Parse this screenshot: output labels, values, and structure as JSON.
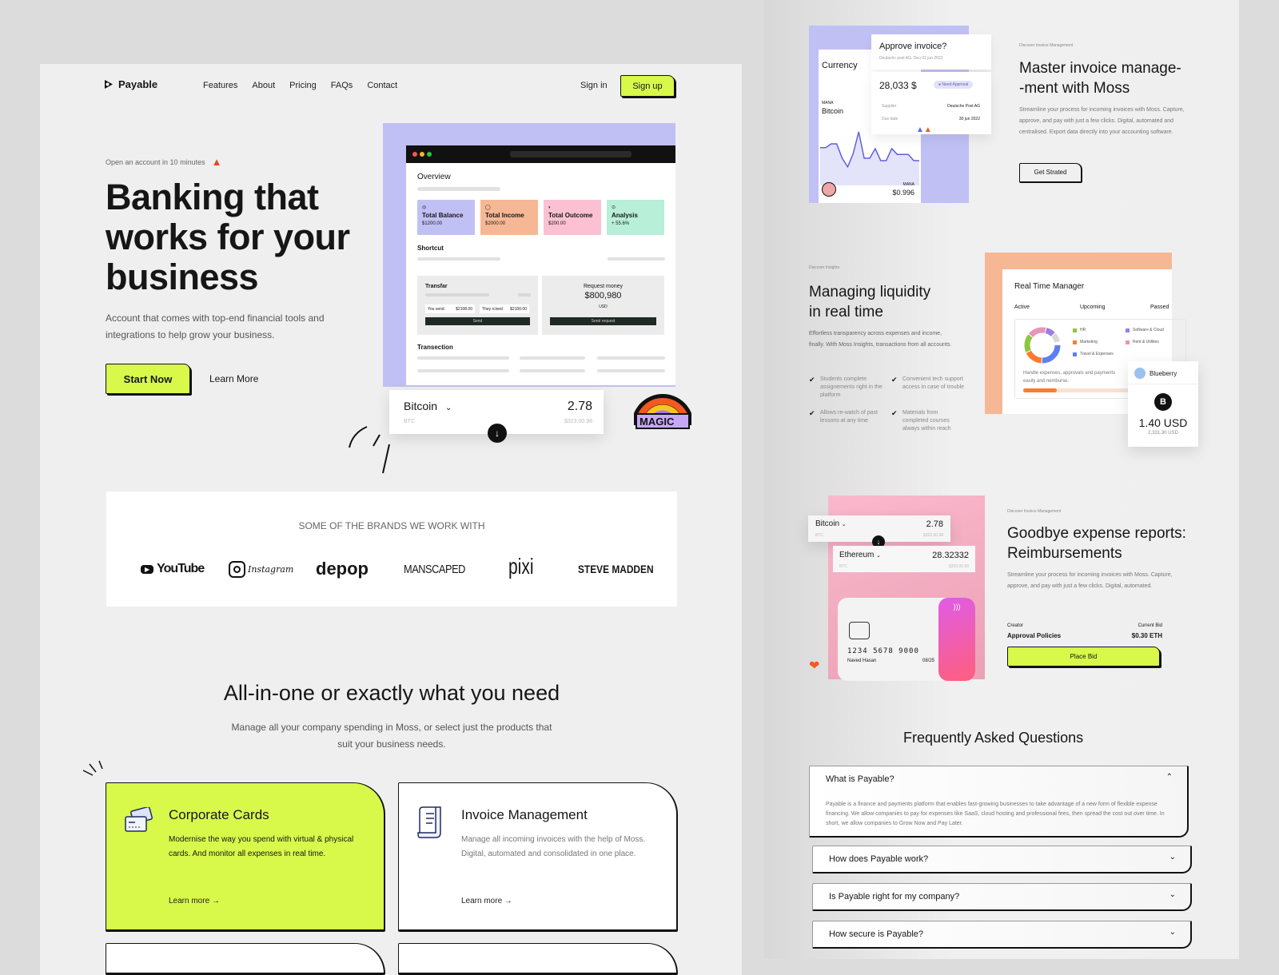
{
  "nav": {
    "brand": "Payable",
    "links": [
      "Features",
      "About",
      "Pricing",
      "FAQs",
      "Contact"
    ],
    "sign_in": "Sign in",
    "sign_up": "Sign up"
  },
  "hero": {
    "eyebrow": "Open an account in 10 minutes",
    "title_lines": [
      "Banking that",
      "works for your",
      "business"
    ],
    "subtitle": "Account that comes with top-end financial tools and integrations to help grow your business.",
    "primary_cta": "Start Now",
    "secondary_cta": "Learn More"
  },
  "dashboard": {
    "overview_title": "Overview",
    "stats": [
      {
        "label": "Total Balance",
        "value": "$1200.00",
        "color": "#c1c0f5"
      },
      {
        "label": "Total Income",
        "value": "$2000.00",
        "color": "#f6b894"
      },
      {
        "label": "Total Outcome",
        "value": "$200.00",
        "color": "#fbc1d2"
      },
      {
        "label": "Analysis",
        "value": "+ 55.6%",
        "color": "#b8efd9"
      }
    ],
    "shortcut_title": "Shortcut",
    "transfer": {
      "title": "Transfar",
      "you_send_label": "You send",
      "you_send_value": "$2108.00",
      "they_receive_label": "They rcived",
      "they_receive_value": "$2100.00",
      "button": "Send"
    },
    "request": {
      "title": "Request money",
      "amount": "$800,980",
      "currency": "USD",
      "button": "Send request"
    },
    "transaction_title": "Transection"
  },
  "crypto_widget": {
    "coin": "Bitcoin",
    "ticker": "BTC",
    "amount": "2.78",
    "usd": "$323,00.98",
    "badge": "MAGIC"
  },
  "brands": {
    "title": "SOME OF THE BRANDS WE WORK WITH",
    "items": [
      "YouTube",
      "Instagram",
      "depop",
      "MANSCAPED",
      "pixi",
      "STEVE MADDEN"
    ]
  },
  "features": {
    "title": "All-in-one or exactly what you need",
    "subtitle": "Manage all your company spending in Moss, or select just the products that suit your business needs.",
    "cards": [
      {
        "title": "Corporate Cards",
        "body": "Modernise the way you spend with virtual & physical cards. And monitor all expenses in real time.",
        "link": "Learn more →"
      },
      {
        "title": "Invoice Management",
        "body": "Manage all incoming invoices with the help of Moss. Digital, automated and consolidated in one place.",
        "link": "Learn more →"
      }
    ]
  },
  "invoice_section": {
    "currency_title": "Currency",
    "coin_ticker": "MANA",
    "coin_name": "Bitcoin",
    "coin_price_label": "MANA",
    "coin_price": "$0.996",
    "approve_title": "Approve invoice?",
    "approve_sub": "Deutschc post AG.  Deu 01 jun 2022",
    "approve_amount": "28,033 $",
    "approve_badge": "Need Approval",
    "supplier_label": "Supplier",
    "supplier_value": "Deutsche Post AG",
    "due_label": "Due date",
    "due_value": "30 jun 2022",
    "eyebrow": "Discover Invoice Management",
    "title_lines": [
      "Master invoice manage-",
      "-ment with Moss"
    ],
    "body": "Streamline your process for incoming invoices with Moss. Capture, approve, and pay with just a few clicks. Digital, automated and centralised. Export data directly into your accounting software.",
    "cta": "Get Strated",
    "chart_points": [
      62,
      62,
      70,
      70,
      40,
      22,
      50,
      95,
      40,
      40,
      60,
      35,
      35,
      60,
      48,
      48,
      48,
      35,
      35
    ]
  },
  "liquidity_section": {
    "eyebrow": "Discover Insights",
    "title_lines": [
      "Managing liquidity",
      "in real time"
    ],
    "body": "Effortless transparency across expenses and income, finally. With Moss Insights, transactions from all accounts.",
    "checks": [
      "Students complete assignements right in the platform",
      "Convenient tech support access in case of trouble",
      "Allows re-watch of past lessons at any time",
      "Materials from completed courses always within reach"
    ],
    "manager_title": "Real Time Manager",
    "tabs": [
      "Active",
      "Upcoming",
      "Passed"
    ],
    "legend": [
      {
        "label": "HR",
        "color": "#8dc63f"
      },
      {
        "label": "Software & Cloud",
        "color": "#9b7fe0"
      },
      {
        "label": "Marketing",
        "color": "#ff7a2e"
      },
      {
        "label": "Rent & Utilities",
        "color": "#e596b9"
      },
      {
        "label": "Travel & Expenses",
        "color": "#5f7fef"
      }
    ],
    "manager_body": "Handle expenses, approvals and payments easily and reimburse.",
    "progress": 0.3,
    "token_name": "Blueberry",
    "token_symbol": "B",
    "token_amount": "1.40 USD",
    "token_sub": "2,331.30 USD"
  },
  "reimburse_section": {
    "swap_from": {
      "coin": "Bitcoin",
      "ticker": "BTC",
      "amount": "2.78",
      "usd": "$323,00.98"
    },
    "swap_to": {
      "coin": "Ethereum",
      "ticker": "BTC",
      "amount": "28.32332",
      "usd": "$323,00.98"
    },
    "card_number": "1234 5678 9000",
    "card_holder": "Naved Hasan",
    "card_expiry": "08/25",
    "eyebrow": "Discover Invoice Management",
    "title_lines": [
      "Goodbye expense reports:",
      "Reimbursements"
    ],
    "body": "Streamline your process for incoming invoices with Moss. Capture, approve, and pay with just a few clicks. Digital, automated.",
    "creator_label": "Creator",
    "creator_value": "Approval Policies",
    "bid_label": "Current Bid",
    "bid_value": "$0.30 ETH",
    "cta": "Place Bid"
  },
  "faq": {
    "title": "Frequently Asked Questions",
    "items": [
      {
        "q": "What is Payable?",
        "a": "Payable is a finance and payments platform that enables fast-growing businesses to take advantage of a new form of flexible expense financing. We allow companies to pay for expenses like SaaS, cloud hosting and professional fees, then spread the cost out over time. In short, we allow companies to Grow Now and Pay Later.",
        "open": true
      },
      {
        "q": "How does Payable work?",
        "open": false
      },
      {
        "q": "Is Payable right for my company?",
        "open": false
      },
      {
        "q": "How secure is Payable?",
        "open": false
      }
    ]
  }
}
